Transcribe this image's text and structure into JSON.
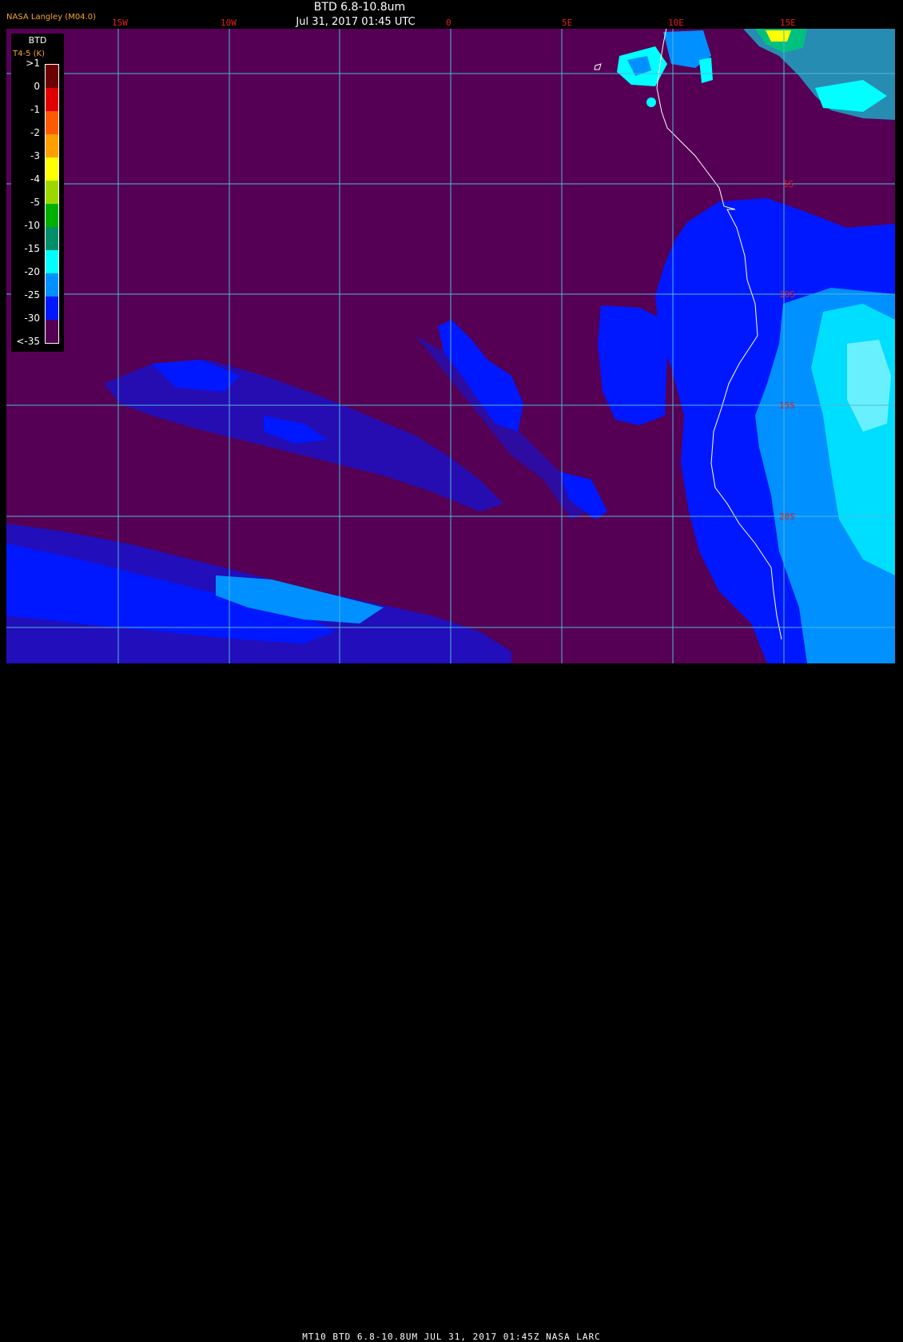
{
  "header": {
    "title": "BTD 6.8-10.8um",
    "datetime": "Jul 31, 2017 01:45 UTC",
    "source": "NASA Langley (M04.0)"
  },
  "legend": {
    "title": "BTD",
    "units": "T4-5 (K)",
    "labels": [
      ">1",
      "0",
      "-1",
      "-2",
      "-3",
      "-4",
      "-5",
      "-10",
      "-15",
      "-20",
      "-25",
      "-30",
      "<-35"
    ],
    "colors": [
      "#6b0000",
      "#e00000",
      "#ff5a00",
      "#ff9e00",
      "#ffff00",
      "#9cd800",
      "#00b000",
      "#008f68",
      "#00ffff",
      "#0090ff",
      "#0018ff",
      "#550055"
    ]
  },
  "map": {
    "lon_labels": [
      "15W",
      "10W",
      "0",
      "5E",
      "10E",
      "15E"
    ],
    "lat_labels": [
      "5S",
      "10S",
      "15S",
      "20S"
    ],
    "colors": {
      "background": "#550055",
      "grid": "#4fb8d8",
      "coast": "#ffffff",
      "cloud_blue": "#0018ff",
      "cloud_lightblue": "#0090ff",
      "cloud_cyan": "#00ffff"
    }
  },
  "footer": {
    "text": "MT10  BTD 6.8-10.8UM   JUL 31, 2017 01:45Z   NASA LARC"
  }
}
